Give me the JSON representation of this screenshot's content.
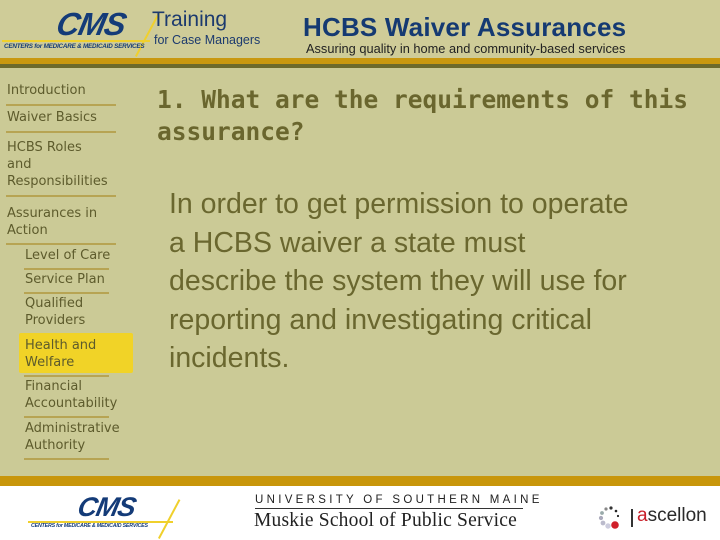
{
  "header": {
    "cms_logo": {
      "word": "CMS",
      "tagline": "CENTERS for MEDICARE & MEDICAID SERVICES"
    },
    "training_title": "Training",
    "training_subtitle": "for Case Managers",
    "course_title": "HCBS Waiver Assurances",
    "course_subtitle": "Assuring quality in home and community-based services"
  },
  "sidebar": {
    "items": [
      {
        "label": "Introduction",
        "level": "top",
        "active": false
      },
      {
        "label": "Waiver Basics",
        "level": "top",
        "active": false
      },
      {
        "label": "HCBS Roles\nand\nResponsibilities",
        "level": "top",
        "active": false
      },
      {
        "label": "Assurances in\nAction",
        "level": "top",
        "active": false
      },
      {
        "label": "Level of Care",
        "level": "sub",
        "active": false
      },
      {
        "label": "Service Plan",
        "level": "sub",
        "active": false
      },
      {
        "label": "Qualified\nProviders",
        "level": "sub",
        "active": false
      },
      {
        "label": "Health and\nWelfare",
        "level": "sub",
        "active": true
      },
      {
        "label": "Financial\nAccountability",
        "level": "sub",
        "active": false
      },
      {
        "label": "Administrative\nAuthority",
        "level": "sub",
        "active": false
      }
    ]
  },
  "main": {
    "question": "1. What are the requirements of this assurance?",
    "body": "In order to get permission to operate a HCBS waiver a state must describe the system they will use for reporting and investigating critical incidents."
  },
  "footer": {
    "cms_logo": {
      "word": "CMS",
      "tagline": "CENTERS for MEDICARE & MEDICAID SERVICES"
    },
    "university": "UNIVERSITY OF SOUTHERN MAINE",
    "school": "Muskie School of Public Service",
    "partner_brand_first": "a",
    "partner_brand_rest": "scellon"
  },
  "colors": {
    "background": "#cbca96",
    "accent_gold": "#c8960b",
    "highlight": "#f1d327",
    "text_olive": "#6a672f",
    "brand_blue": "#153a72"
  }
}
